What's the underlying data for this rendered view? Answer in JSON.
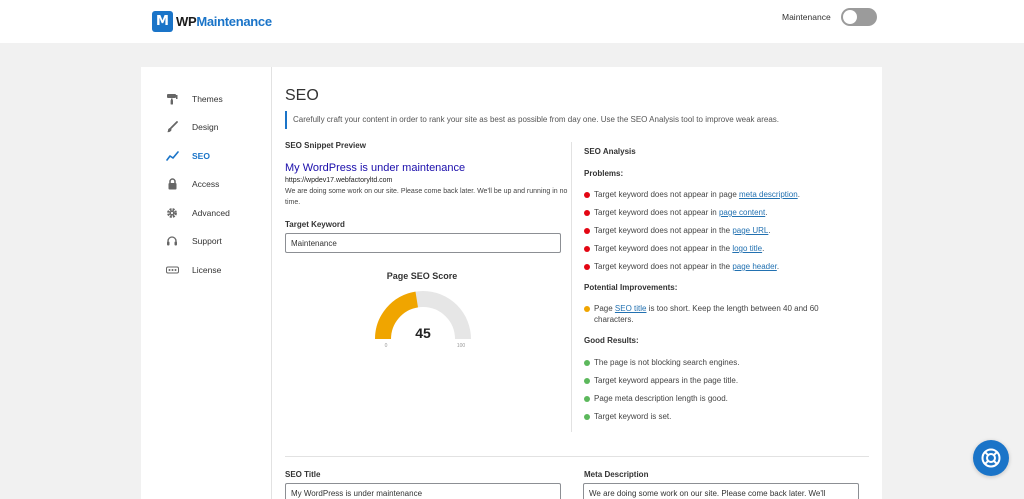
{
  "header": {
    "logo_mark": "M",
    "logo_wp": "WP",
    "logo_name": "Maintenance",
    "maintenance_label": "Maintenance",
    "maintenance_toggle": "off"
  },
  "sidebar": {
    "items": [
      {
        "label": "Themes",
        "icon": "paint-roller-icon"
      },
      {
        "label": "Design",
        "icon": "brush-icon"
      },
      {
        "label": "SEO",
        "icon": "chart-line-icon",
        "active": true
      },
      {
        "label": "Access",
        "icon": "lock-icon"
      },
      {
        "label": "Advanced",
        "icon": "gear-icon"
      },
      {
        "label": "Support",
        "icon": "headset-icon"
      },
      {
        "label": "License",
        "icon": "ellipsis-icon"
      }
    ]
  },
  "main": {
    "title": "SEO",
    "intro": "Carefully craft your content in order to rank your site as best as possible from day one. Use the SEO Analysis tool to improve weak areas.",
    "snippet": {
      "heading": "SEO Snippet Preview",
      "title": "My WordPress is under maintenance",
      "url": "https://wpdev17.webfactoryltd.com",
      "description": "We are doing some work on our site. Please come back later. We'll be up and running in no time."
    },
    "keyword": {
      "label": "Target Keyword",
      "value": "Maintenance"
    },
    "score": {
      "title": "Page SEO Score",
      "value": 45,
      "value_text": "45",
      "min_label": "0",
      "max_label": "100"
    },
    "analysis": {
      "heading": "SEO Analysis",
      "problems_heading": "Problems:",
      "problems": [
        {
          "pre": "Target keyword does not appear in page ",
          "link": "meta description",
          "post": "."
        },
        {
          "pre": "Target keyword does not appear in ",
          "link": "page content",
          "post": "."
        },
        {
          "pre": "Target keyword does not appear in the ",
          "link": "page URL",
          "post": "."
        },
        {
          "pre": "Target keyword does not appear in the ",
          "link": "logo title",
          "post": "."
        },
        {
          "pre": "Target keyword does not appear in the ",
          "link": "page header",
          "post": "."
        }
      ],
      "improvements_heading": "Potential Improvements:",
      "improvements": [
        {
          "pre": "Page ",
          "link": "SEO title",
          "post": " is too short. Keep the length between 40 and 60 characters."
        }
      ],
      "good_heading": "Good Results:",
      "good": [
        "The page is not blocking search engines.",
        "Target keyword appears in the page title.",
        "Page meta description length is good.",
        "Target keyword is set."
      ]
    },
    "seo_title": {
      "label": "SEO Title",
      "value": "My WordPress is under maintenance"
    },
    "meta_description": {
      "label": "Meta Description",
      "value": "We are doing some work on our site. Please come back later. We'll"
    }
  },
  "colors": {
    "accent": "#1a74c8",
    "problem": "#e30613",
    "improvement": "#f0a500",
    "good": "#5cb85c",
    "gauge_track": "#e6e6e6"
  }
}
